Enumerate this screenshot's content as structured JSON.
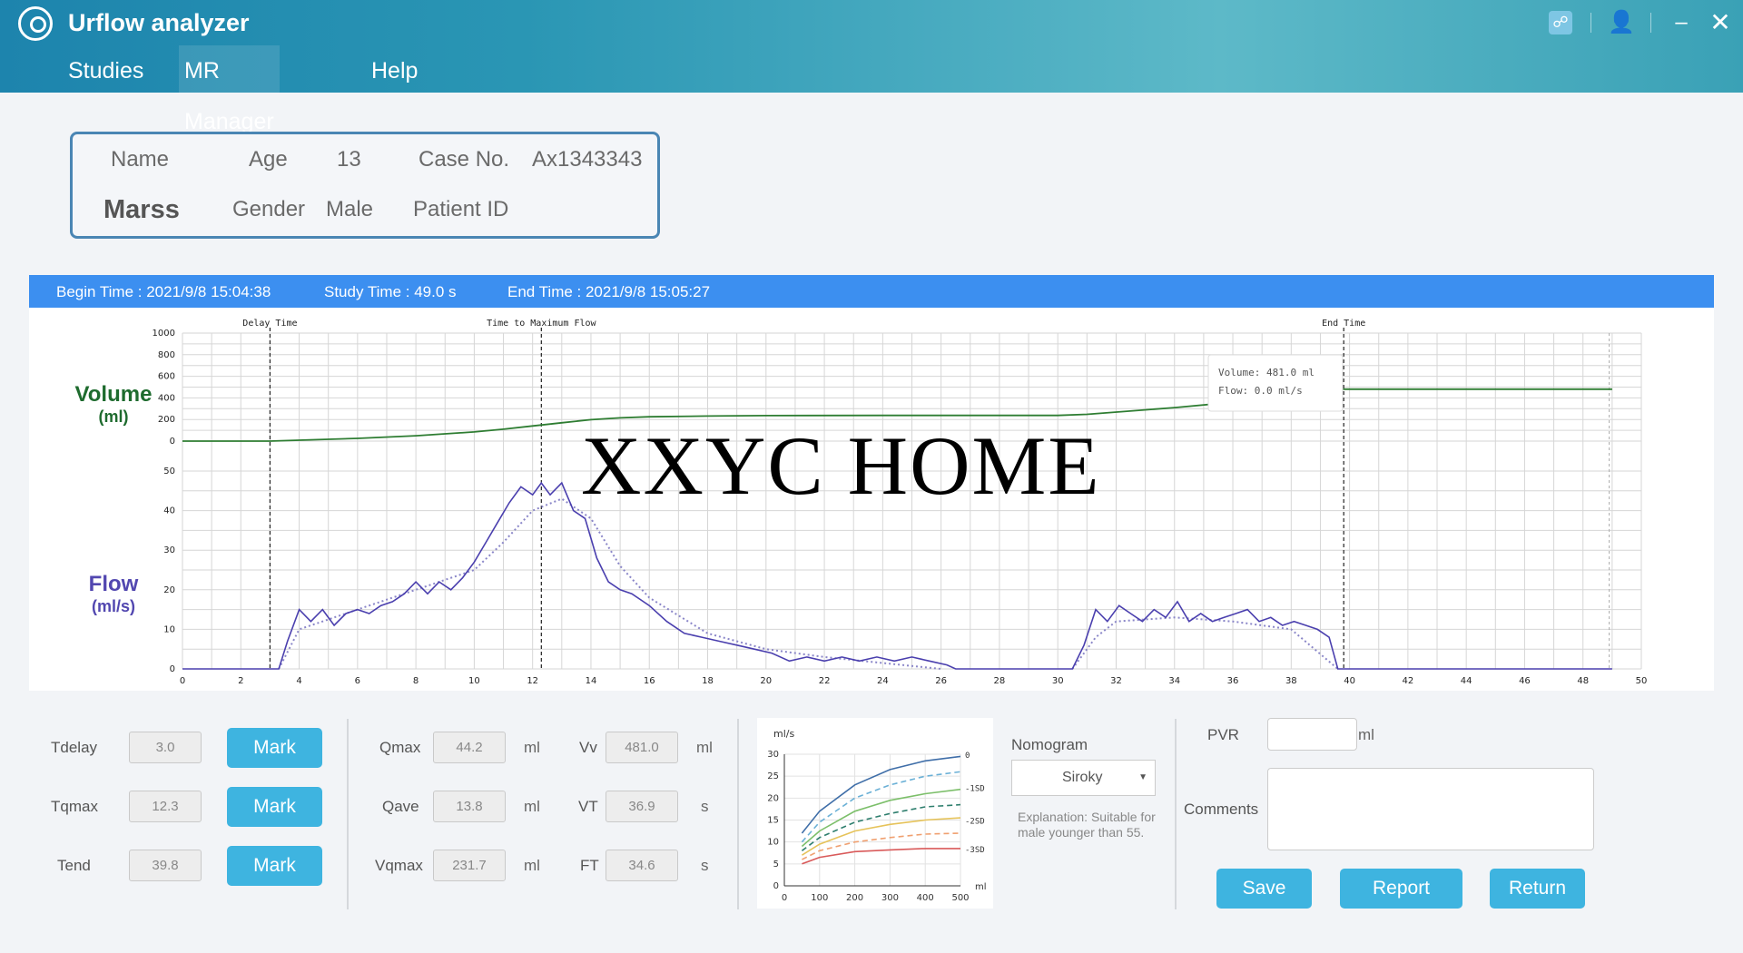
{
  "app": {
    "title": "Urflow analyzer"
  },
  "menu": [
    {
      "label": "Studies"
    },
    {
      "label": "MR Manager"
    },
    {
      "label": "Help"
    }
  ],
  "patient": {
    "name_label": "Name",
    "name": "Marss",
    "age_label": "Age",
    "age": "13",
    "gender_label": "Gender",
    "gender": "Male",
    "case_label": "Case No.",
    "case_no": "Ax1343343",
    "patient_id_label": "Patient ID"
  },
  "study": {
    "begin": "Begin Time :  2021/9/8 15:04:38",
    "study_time": "Study Time :  49.0 s",
    "end": "End Time :  2021/9/8 15:05:27"
  },
  "axes": {
    "volume_label": "Volume",
    "volume_unit": "(ml)",
    "flow_label": "Flow",
    "flow_unit": "(ml/s)"
  },
  "tooltip": {
    "volume": "Volume: 481.0 ml",
    "flow": "Flow: 0.0 ml/s"
  },
  "watermark": "XXYC  HOME",
  "chart_data": {
    "type": "line",
    "x_ticks": [
      0,
      2,
      4,
      6,
      8,
      10,
      12,
      14,
      16,
      18,
      20,
      22,
      24,
      26,
      28,
      30,
      32,
      34,
      36,
      38,
      40,
      42,
      44,
      46,
      48,
      50
    ],
    "xlim": [
      0,
      50
    ],
    "volume_ticks": [
      0,
      200,
      400,
      600,
      800,
      1000
    ],
    "volume_ylim": [
      0,
      1000
    ],
    "flow_ticks": [
      0,
      10,
      20,
      30,
      40,
      50
    ],
    "flow_ylim": [
      0,
      50
    ],
    "markers": [
      {
        "label": "Delay Time",
        "x": 3.0
      },
      {
        "label": "Time to Maximum Flow",
        "x": 12.3
      },
      {
        "label": "End Time",
        "x": 39.8
      }
    ],
    "grid": true,
    "volume_series": {
      "name": "Volume",
      "x": [
        0,
        3,
        4,
        6,
        8,
        10,
        11,
        12,
        13,
        14,
        15,
        16,
        18,
        20,
        24,
        28,
        30,
        31,
        34,
        36,
        38,
        39.8,
        49
      ],
      "y": [
        0,
        0,
        8,
        25,
        50,
        85,
        110,
        140,
        170,
        198,
        215,
        225,
        232,
        236,
        238,
        238,
        238,
        248,
        310,
        360,
        420,
        481,
        481
      ]
    },
    "flow_series": {
      "name": "Flow",
      "x": [
        0,
        3.3,
        3.6,
        4,
        4.4,
        4.8,
        5.2,
        5.6,
        6,
        6.4,
        6.8,
        7.2,
        7.6,
        8,
        8.4,
        8.8,
        9.2,
        9.6,
        10,
        10.4,
        10.8,
        11.2,
        11.6,
        12,
        12.3,
        12.6,
        13,
        13.4,
        13.8,
        14.2,
        14.6,
        15,
        15.4,
        16,
        16.6,
        17.2,
        17.8,
        18.4,
        19,
        19.6,
        20.2,
        20.8,
        21.4,
        22,
        22.6,
        23.2,
        23.8,
        24.4,
        25,
        25.6,
        26.2,
        26.5,
        30.5,
        30.9,
        31.3,
        31.7,
        32.1,
        32.5,
        32.9,
        33.3,
        33.7,
        34.1,
        34.5,
        34.9,
        35.3,
        35.7,
        36.1,
        36.5,
        36.9,
        37.3,
        37.7,
        38.1,
        38.5,
        38.9,
        39.3,
        39.6,
        49
      ],
      "y": [
        0,
        0,
        7,
        15,
        12,
        15,
        11,
        14,
        15,
        14,
        16,
        17,
        19,
        22,
        19,
        22,
        20,
        23,
        27,
        32,
        37,
        42,
        46,
        44,
        47,
        44,
        47,
        40,
        38,
        28,
        22,
        20,
        19,
        16,
        12,
        9,
        8,
        7,
        6,
        5,
        4,
        2,
        3,
        2,
        3,
        2,
        3,
        2,
        3,
        2,
        1,
        0,
        0,
        6,
        15,
        12,
        16,
        14,
        12,
        15,
        13,
        17,
        12,
        14,
        12,
        13,
        14,
        15,
        12,
        13,
        11,
        12,
        11,
        10,
        8,
        0,
        0
      ]
    },
    "flow_trend": {
      "x": [
        3.3,
        4,
        6,
        8,
        10,
        11,
        12,
        13,
        14,
        15,
        16,
        18,
        20,
        22,
        24,
        26
      ],
      "y": [
        0,
        10,
        15,
        20,
        25,
        32,
        40,
        43,
        38,
        26,
        18,
        9,
        5,
        3,
        1.5,
        0
      ]
    },
    "flow_trend2": {
      "x": [
        30.5,
        31.3,
        32,
        34,
        36,
        38,
        39.6
      ],
      "y": [
        0,
        8,
        12,
        13,
        12,
        10,
        0
      ]
    }
  },
  "params": {
    "tdelay": {
      "label": "Tdelay",
      "value": "3.0",
      "btn": "Mark"
    },
    "tqmax": {
      "label": "Tqmax",
      "value": "12.3",
      "btn": "Mark"
    },
    "tend": {
      "label": "Tend",
      "value": "39.8",
      "btn": "Mark"
    },
    "qmax": {
      "label": "Qmax",
      "value": "44.2",
      "unit": "ml"
    },
    "qave": {
      "label": "Qave",
      "value": "13.8",
      "unit": "ml"
    },
    "vqmax": {
      "label": "Vqmax",
      "value": "231.7",
      "unit": "ml"
    },
    "vv": {
      "label": "Vv",
      "value": "481.0",
      "unit": "ml"
    },
    "vt": {
      "label": "VT",
      "value": "36.9",
      "unit": "s"
    },
    "ft": {
      "label": "FT",
      "value": "34.6",
      "unit": "s"
    }
  },
  "nomogram": {
    "label": "Nomogram",
    "selected": "Siroky",
    "explanation": "Explanation: Suitable for male younger than 55.",
    "chart_data": {
      "type": "line",
      "y_unit": "ml/s",
      "x_unit": "ml",
      "x_ticks": [
        0,
        100,
        200,
        300,
        400,
        500
      ],
      "y_ticks": [
        0,
        5,
        10,
        15,
        20,
        25,
        30
      ],
      "right_labels": [
        "0",
        "-1SD",
        "-2SD",
        "-3SD"
      ],
      "series": [
        {
          "color": "#3f6ea8",
          "dash": false,
          "x": [
            50,
            100,
            200,
            300,
            400,
            500
          ],
          "y": [
            12,
            17,
            23,
            26.5,
            28.5,
            29.5
          ]
        },
        {
          "color": "#6ab0d6",
          "dash": true,
          "x": [
            50,
            100,
            200,
            300,
            400,
            500
          ],
          "y": [
            10,
            14.5,
            20,
            23,
            25,
            26
          ]
        },
        {
          "color": "#7cbf6a",
          "dash": false,
          "x": [
            50,
            100,
            200,
            300,
            400,
            500
          ],
          "y": [
            9,
            12.5,
            17,
            19.5,
            21,
            22
          ]
        },
        {
          "color": "#2f7f6e",
          "dash": true,
          "x": [
            50,
            100,
            200,
            300,
            400,
            500
          ],
          "y": [
            8,
            11,
            14.5,
            16.5,
            18,
            18.5
          ]
        },
        {
          "color": "#e6c35a",
          "dash": false,
          "x": [
            50,
            100,
            200,
            300,
            400,
            500
          ],
          "y": [
            7,
            9.5,
            12.5,
            14,
            15,
            15.5
          ]
        },
        {
          "color": "#f0a070",
          "dash": true,
          "x": [
            50,
            100,
            200,
            300,
            400,
            500
          ],
          "y": [
            6,
            8,
            10,
            11,
            11.8,
            12
          ]
        },
        {
          "color": "#d95a5a",
          "dash": false,
          "x": [
            50,
            100,
            200,
            300,
            400,
            500
          ],
          "y": [
            5,
            6.5,
            7.8,
            8.2,
            8.5,
            8.5
          ]
        }
      ]
    }
  },
  "right_panel": {
    "pvr_label": "PVR",
    "pvr_unit": "ml",
    "comments_label": "Comments",
    "save": "Save",
    "report": "Report",
    "return": "Return"
  },
  "colors": {
    "header": "#2a96b4",
    "time_bar": "#3c8ff0",
    "volume": "#2e7d32",
    "flow": "#4a3fae",
    "button": "#3eb4e0"
  }
}
